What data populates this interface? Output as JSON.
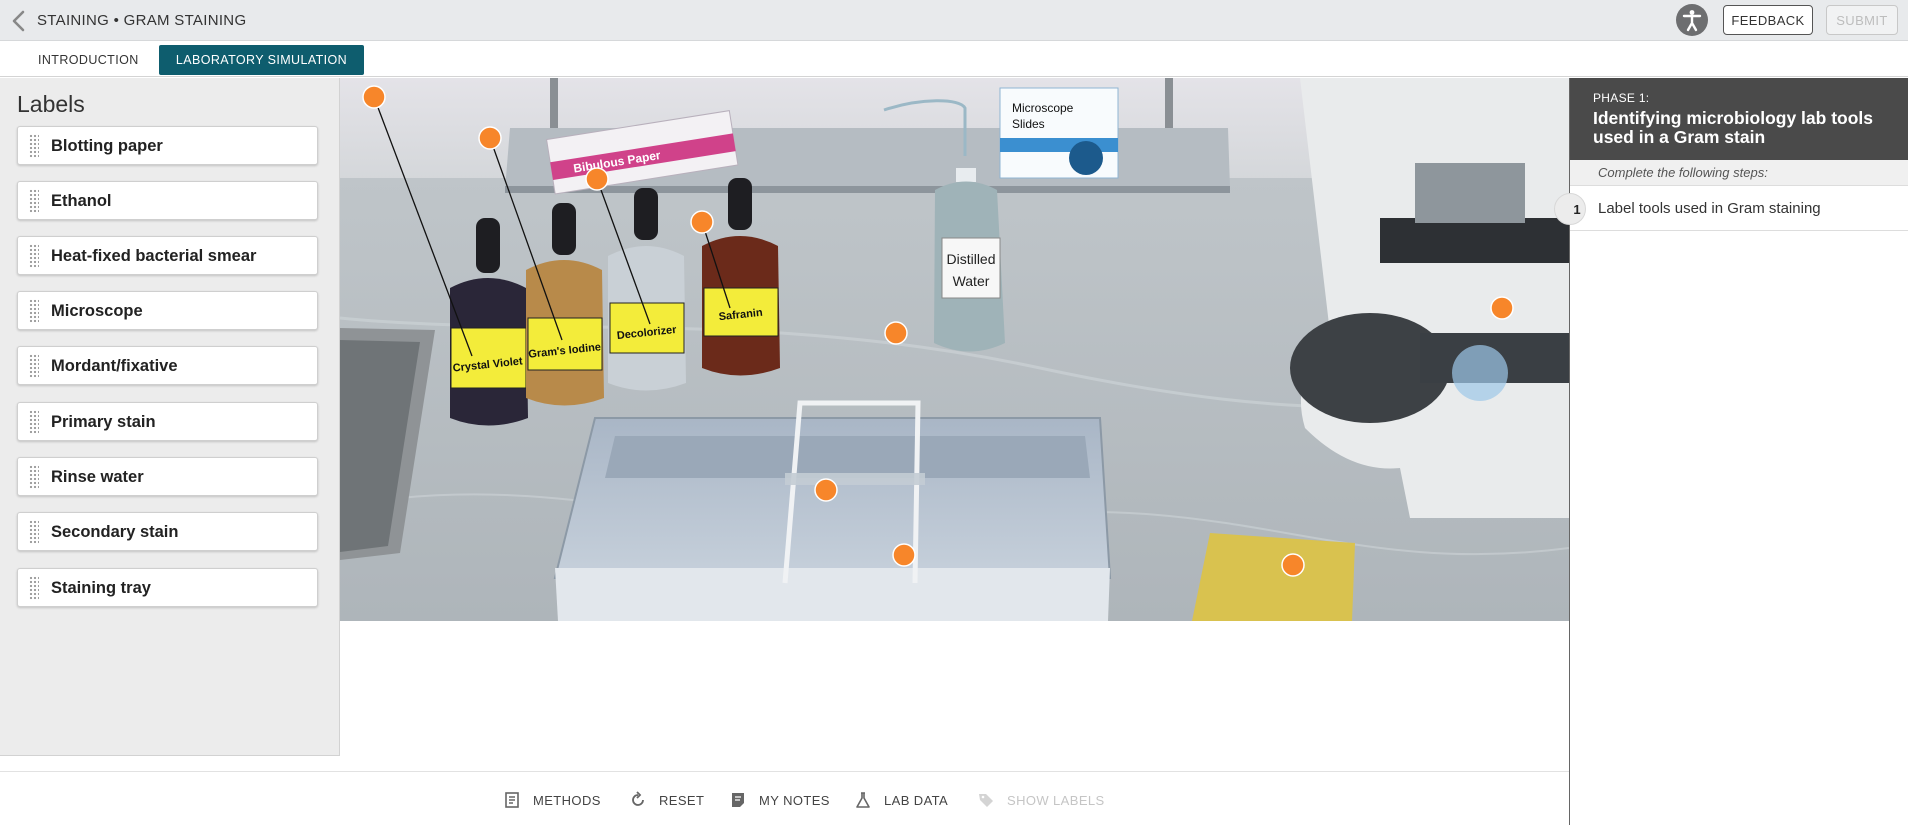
{
  "header": {
    "breadcrumb": "STAINING • GRAM STAINING",
    "feedback_label": "FEEDBACK",
    "submit_label": "SUBMIT"
  },
  "tabs": [
    {
      "label": "INTRODUCTION",
      "active": false
    },
    {
      "label": "LABORATORY SIMULATION",
      "active": true
    }
  ],
  "labels_panel": {
    "title": "Labels",
    "items": [
      {
        "label": "Blotting paper"
      },
      {
        "label": "Ethanol"
      },
      {
        "label": "Heat-fixed bacterial smear"
      },
      {
        "label": "Microscope"
      },
      {
        "label": "Mordant/fixative"
      },
      {
        "label": "Primary stain"
      },
      {
        "label": "Rinse water"
      },
      {
        "label": "Secondary stain"
      },
      {
        "label": "Staining tray"
      }
    ]
  },
  "scene": {
    "bottle_labels": {
      "crystal_violet": "Crystal Violet",
      "grams_iodine": "Gram's Iodine",
      "decolorizer": "Decolorizer",
      "safranin": "Safranin",
      "distilled_water_1": "Distilled",
      "distilled_water_2": "Water"
    },
    "bibulous_paper": "Bibulous Paper",
    "slides_box_1": "Microscope",
    "slides_box_2": "Slides",
    "hotspot_color": "#f7862a"
  },
  "right_panel": {
    "phase_label": "PHASE 1:",
    "phase_title": "Identifying microbiology lab tools used in a Gram stain",
    "steps_intro": "Complete the following steps:",
    "steps": [
      {
        "number": "1",
        "text": "Label tools used in Gram staining"
      }
    ]
  },
  "toolbar": {
    "methods": "METHODS",
    "reset": "RESET",
    "my_notes": "MY NOTES",
    "lab_data": "LAB DATA",
    "show_labels": "SHOW LABELS"
  },
  "colors": {
    "accent_tab": "#0e5d6e",
    "phase_header": "#4a4a4a",
    "hotspot": "#f7862a"
  }
}
